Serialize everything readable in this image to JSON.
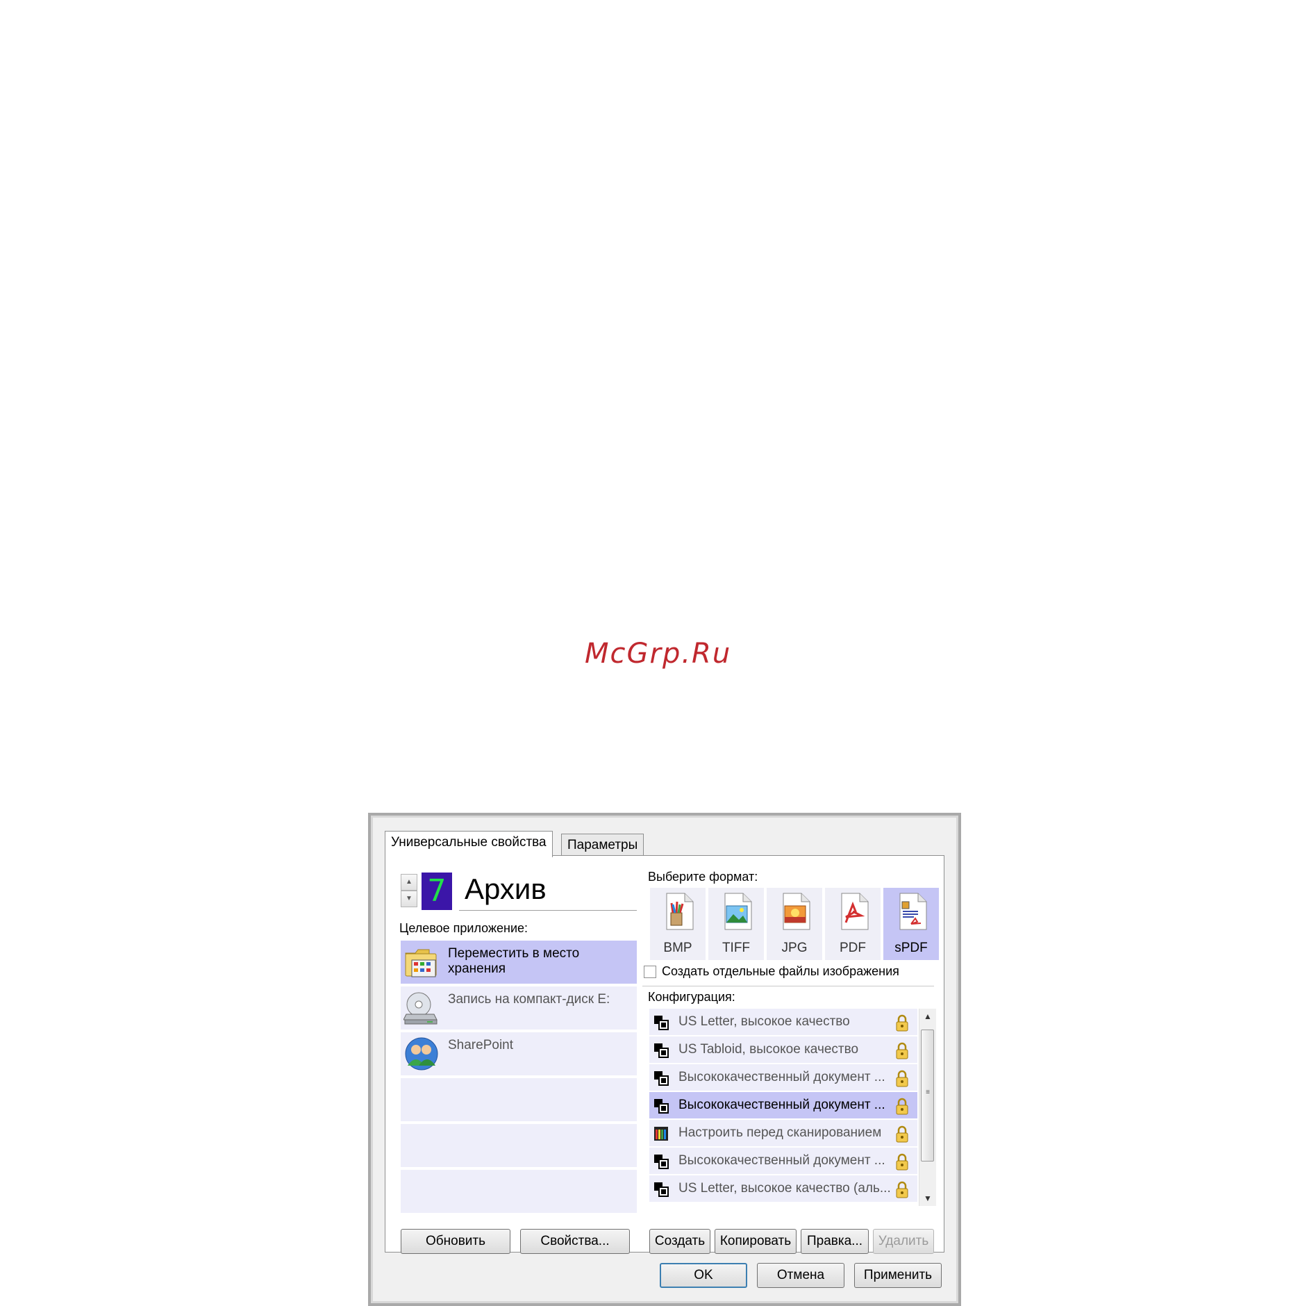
{
  "watermark": "McGrp.Ru",
  "tabs": [
    "Универсальные свойства",
    "Параметры"
  ],
  "profile": {
    "number": "7",
    "name": "Архив"
  },
  "target_label": "Целевое приложение:",
  "apps": [
    {
      "line1": "Переместить в место",
      "line2": "хранения",
      "icon": "folder-storage-icon"
    },
    {
      "line1": "Запись на компакт-диск  E:",
      "line2": "",
      "icon": "cd-burner-icon"
    },
    {
      "line1": "SharePoint",
      "line2": "",
      "icon": "sharepoint-users-icon"
    }
  ],
  "left_buttons": {
    "refresh": "Обновить",
    "properties": "Свойства..."
  },
  "format_label": "Выберите формат:",
  "formats": [
    "BMP",
    "TIFF",
    "JPG",
    "PDF",
    "sPDF"
  ],
  "selected_format": "sPDF",
  "separate_files_label": "Создать отдельные файлы изображения",
  "config_label": "Конфигурация:",
  "configs": [
    "US Letter, высокое качество",
    "US Tabloid, высокое качество",
    "Высококачественный документ ...",
    "Высококачественный документ ...",
    "Настроить перед сканированием",
    "Высококачественный документ ...",
    "US Letter, высокое качество (аль..."
  ],
  "right_buttons": {
    "create": "Создать",
    "copy": "Копировать",
    "edit": "Правка...",
    "delete": "Удалить"
  },
  "dialog_buttons": {
    "ok": "OK",
    "cancel": "Отмена",
    "apply": "Применить"
  },
  "colors": {
    "selection": "#c5c5f5",
    "list_background": "#eeeefa",
    "lcd_background": "#3b16a8",
    "lcd_digit": "#22e04a",
    "watermark": "#c0282e"
  }
}
